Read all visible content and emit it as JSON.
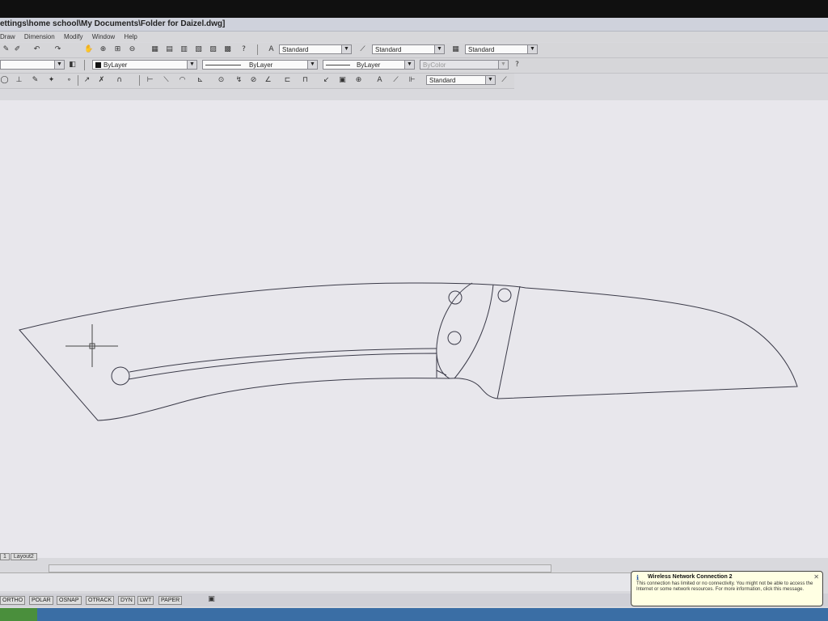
{
  "window": {
    "title": "ettings\\home school\\My Documents\\Folder for Daizel.dwg]"
  },
  "menu": [
    "Draw",
    "Dimension",
    "Modify",
    "Window",
    "Help"
  ],
  "toolbar_styles": {
    "text_style": "Standard",
    "dim_style": "Standard",
    "table_style": "Standard"
  },
  "toolbar_props": {
    "layer_color": "ByLayer",
    "linetype": "ByLayer",
    "lineweight": "ByLayer",
    "plot_style": "ByColor"
  },
  "toolbar_dim": {
    "dim_style": "Standard"
  },
  "layout_tabs": [
    "1",
    "Layout2"
  ],
  "status_buttons": [
    "ORTHO",
    "POLAR",
    "OSNAP",
    "OTRACK",
    "DYN",
    "LWT",
    "PAPER"
  ],
  "notification": {
    "title": "Wireless Network Connection 2",
    "body": "This connection has limited or no connectivity. You might not be able to access the Internet or some network resources. For more information, click this message."
  },
  "colors": {
    "canvas_bg": "#e8e7ec",
    "drawing_line": "#3a3a48",
    "taskbar": "#3a6ea5",
    "balloon_bg": "#ffffe3"
  },
  "icons": {
    "notification": "info-icon",
    "close": "close-icon"
  }
}
